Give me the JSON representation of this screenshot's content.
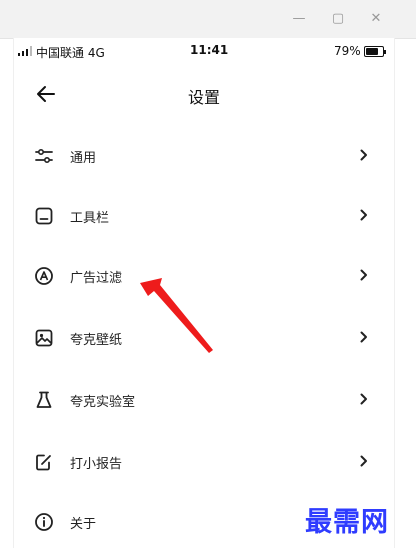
{
  "window": {
    "minimize": "—",
    "maximize": "▢",
    "close": "✕"
  },
  "statusbar": {
    "carrier": "中国联通 4G",
    "time": "11:41",
    "battery": "79%"
  },
  "header": {
    "title": "设置"
  },
  "menu": [
    {
      "label": "通用",
      "icon": "sliders-icon"
    },
    {
      "label": "工具栏",
      "icon": "toolbar-icon"
    },
    {
      "label": "广告过滤",
      "icon": "ad-filter-icon"
    },
    {
      "label": "夸克壁纸",
      "icon": "wallpaper-icon"
    },
    {
      "label": "夸克实验室",
      "icon": "flask-icon"
    },
    {
      "label": "打小报告",
      "icon": "report-icon"
    },
    {
      "label": "关于",
      "icon": "info-icon"
    }
  ],
  "annotation": {
    "color": "#ee1c1c"
  },
  "watermark": "最需网"
}
